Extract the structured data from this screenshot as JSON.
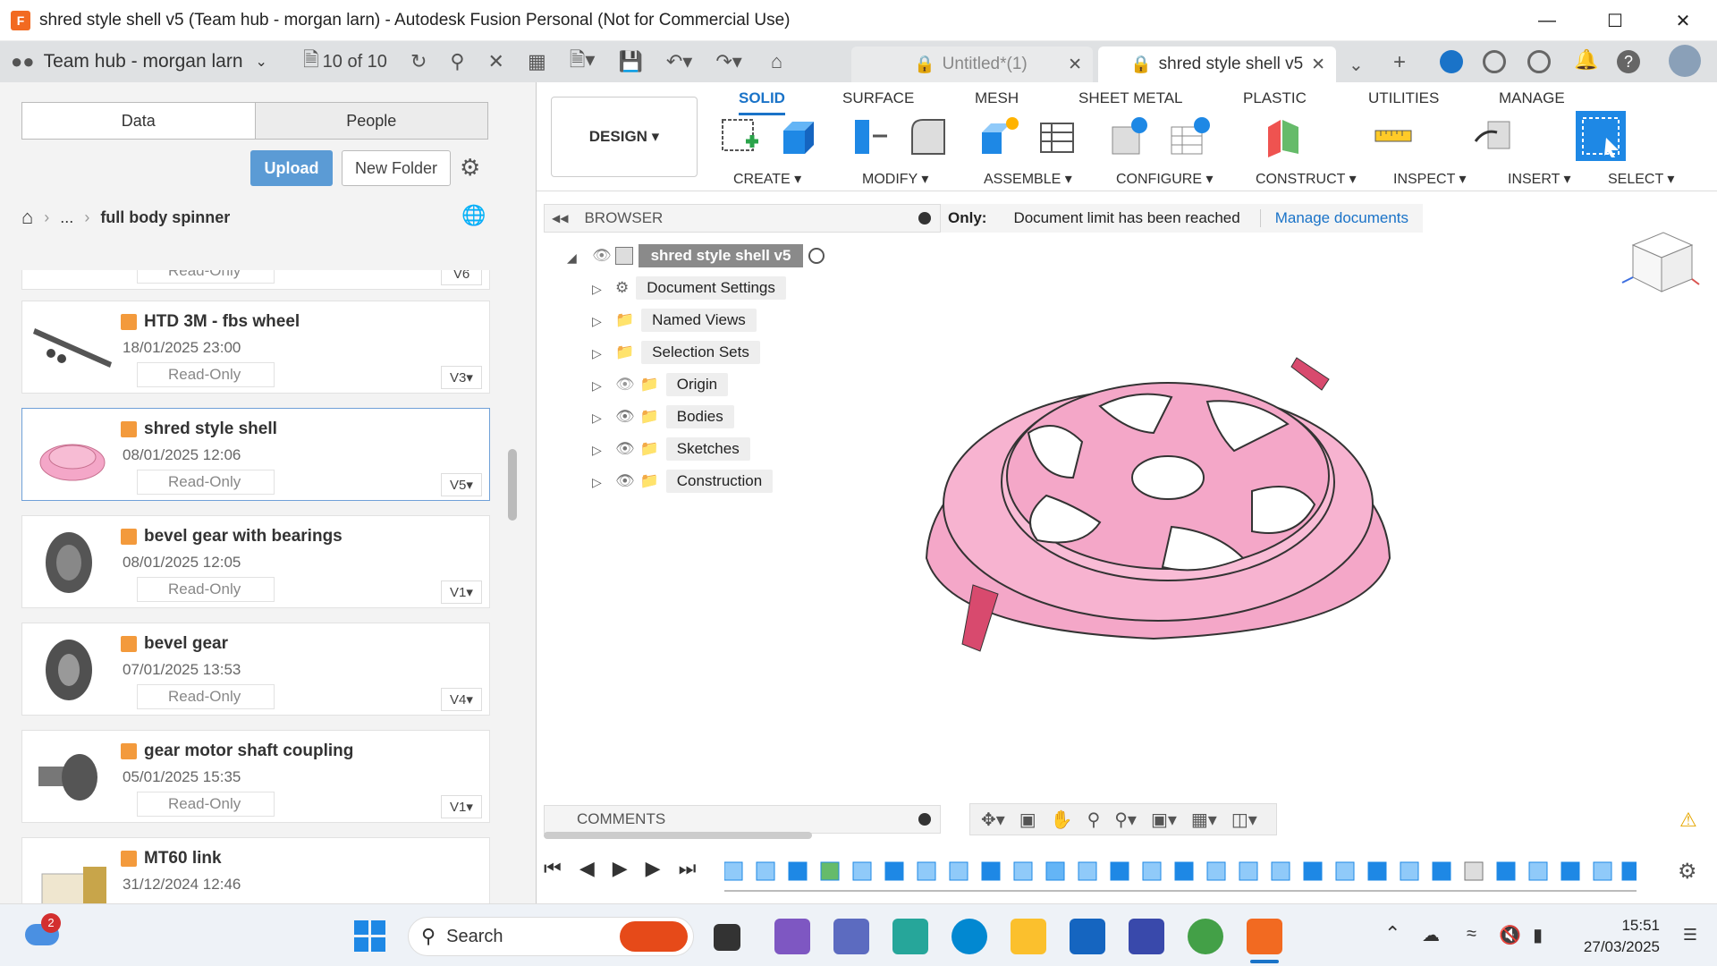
{
  "window": {
    "title": "shred style shell v5 (Team hub - morgan larn) - Autodesk Fusion Personal (Not for Commercial Use)",
    "app_icon_label": "F"
  },
  "toolbar": {
    "hub": "Team hub - morgan larn",
    "doc_count": "10 of 10"
  },
  "tabs": [
    {
      "label": "Untitled*(1)"
    },
    {
      "label": "shred style shell v5"
    }
  ],
  "panel": {
    "seg_data": "Data",
    "seg_people": "People",
    "upload": "Upload",
    "new_folder": "New Folder",
    "crumb_ellipsis": "...",
    "crumb_folder": "full body spinner",
    "files": [
      {
        "name": "HTD 3M - fbs wheel",
        "date": "18/01/2025 23:00",
        "status": "Read-Only",
        "version": "V3"
      },
      {
        "name": "shred style shell",
        "date": "08/01/2025 12:06",
        "status": "Read-Only",
        "version": "V5"
      },
      {
        "name": "bevel gear with bearings",
        "date": "08/01/2025 12:05",
        "status": "Read-Only",
        "version": "V1"
      },
      {
        "name": "bevel gear",
        "date": "07/01/2025 13:53",
        "status": "Read-Only",
        "version": "V4"
      },
      {
        "name": "gear motor shaft coupling",
        "date": "05/01/2025 15:35",
        "status": "Read-Only",
        "version": "V1"
      },
      {
        "name": "MT60 link",
        "date": "31/12/2024 12:46",
        "status": "",
        "version": ""
      }
    ],
    "partial_top": {
      "status": "Read-Only",
      "version": "V6"
    }
  },
  "ribbon": {
    "design": "DESIGN",
    "tabs": [
      "SOLID",
      "SURFACE",
      "MESH",
      "SHEET METAL",
      "PLASTIC",
      "UTILITIES",
      "MANAGE"
    ],
    "groups": [
      "CREATE",
      "MODIFY",
      "ASSEMBLE",
      "CONFIGURE",
      "CONSTRUCT",
      "INSPECT",
      "INSERT",
      "SELECT"
    ]
  },
  "browser": {
    "title": "BROWSER",
    "root": "shred style shell v5",
    "items": [
      "Document Settings",
      "Named Views",
      "Selection Sets",
      "Origin",
      "Bodies",
      "Sketches",
      "Construction"
    ]
  },
  "notice": {
    "prefix": "Only:",
    "message": "Document limit has been reached",
    "link": "Manage documents"
  },
  "comments": {
    "title": "COMMENTS"
  },
  "taskbar": {
    "search": "Search",
    "time": "15:51",
    "date": "27/03/2025",
    "weather_badge": "2"
  },
  "colors": {
    "accent": "#1a73c8",
    "model_pink": "#f4a7c8",
    "model_dark": "#d84a6e"
  }
}
